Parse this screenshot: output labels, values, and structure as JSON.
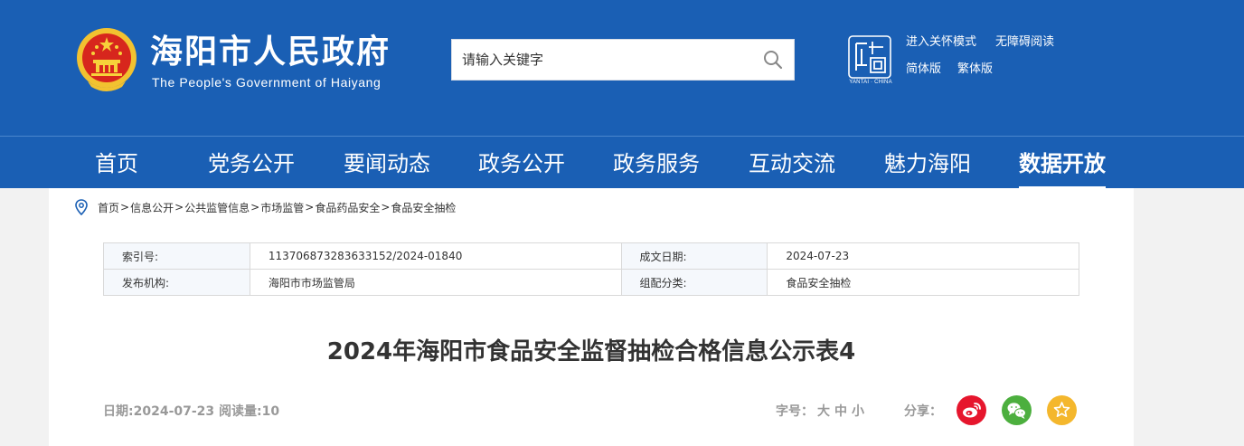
{
  "header": {
    "site_title": "海阳市人民政府",
    "site_subtitle": "The People's Government of Haiyang",
    "search_placeholder": "请输入关键字",
    "city_logo_caption": "YANTAI · CHINA",
    "tools": {
      "care_mode": "进入关怀模式",
      "accessible": "无障碍阅读",
      "simplified": "简体版",
      "traditional": "繁体版"
    }
  },
  "nav": {
    "items": [
      {
        "label": "首页"
      },
      {
        "label": "党务公开"
      },
      {
        "label": "要闻动态"
      },
      {
        "label": "政务公开"
      },
      {
        "label": "政务服务"
      },
      {
        "label": "互动交流"
      },
      {
        "label": "魅力海阳"
      },
      {
        "label": "数据开放"
      }
    ],
    "active": "数据开放"
  },
  "breadcrumb": {
    "items": [
      "首页",
      "信息公开",
      "公共监管信息",
      "市场监管",
      "食品药品安全",
      "食品安全抽检"
    ],
    "separator": ">"
  },
  "meta": {
    "index_label": "索引号:",
    "index_value": "113706873283633152/2024-01840",
    "date_label": "成文日期:",
    "date_value": "2024-07-23",
    "publisher_label": "发布机构:",
    "publisher_value": "海阳市市场监管局",
    "category_label": "组配分类:",
    "category_value": "食品安全抽检"
  },
  "article": {
    "title": "2024年海阳市食品安全监督抽检合格信息公示表4",
    "info": "日期:2024-07-23 阅读量:10",
    "font_size_label": "字号：",
    "font_large": "大",
    "font_medium": "中",
    "font_small": "小",
    "share_label": "分享："
  },
  "colors": {
    "header_blue": "#1a5fb4",
    "weibo_red": "#e6162d",
    "wechat_green": "#4caf3e",
    "favorite_yellow": "#f4b72d"
  },
  "icons": [
    "national-emblem-icon",
    "search-icon",
    "yantai-china-logo-icon",
    "location-pin-icon",
    "weibo-icon",
    "wechat-icon",
    "star-icon"
  ]
}
